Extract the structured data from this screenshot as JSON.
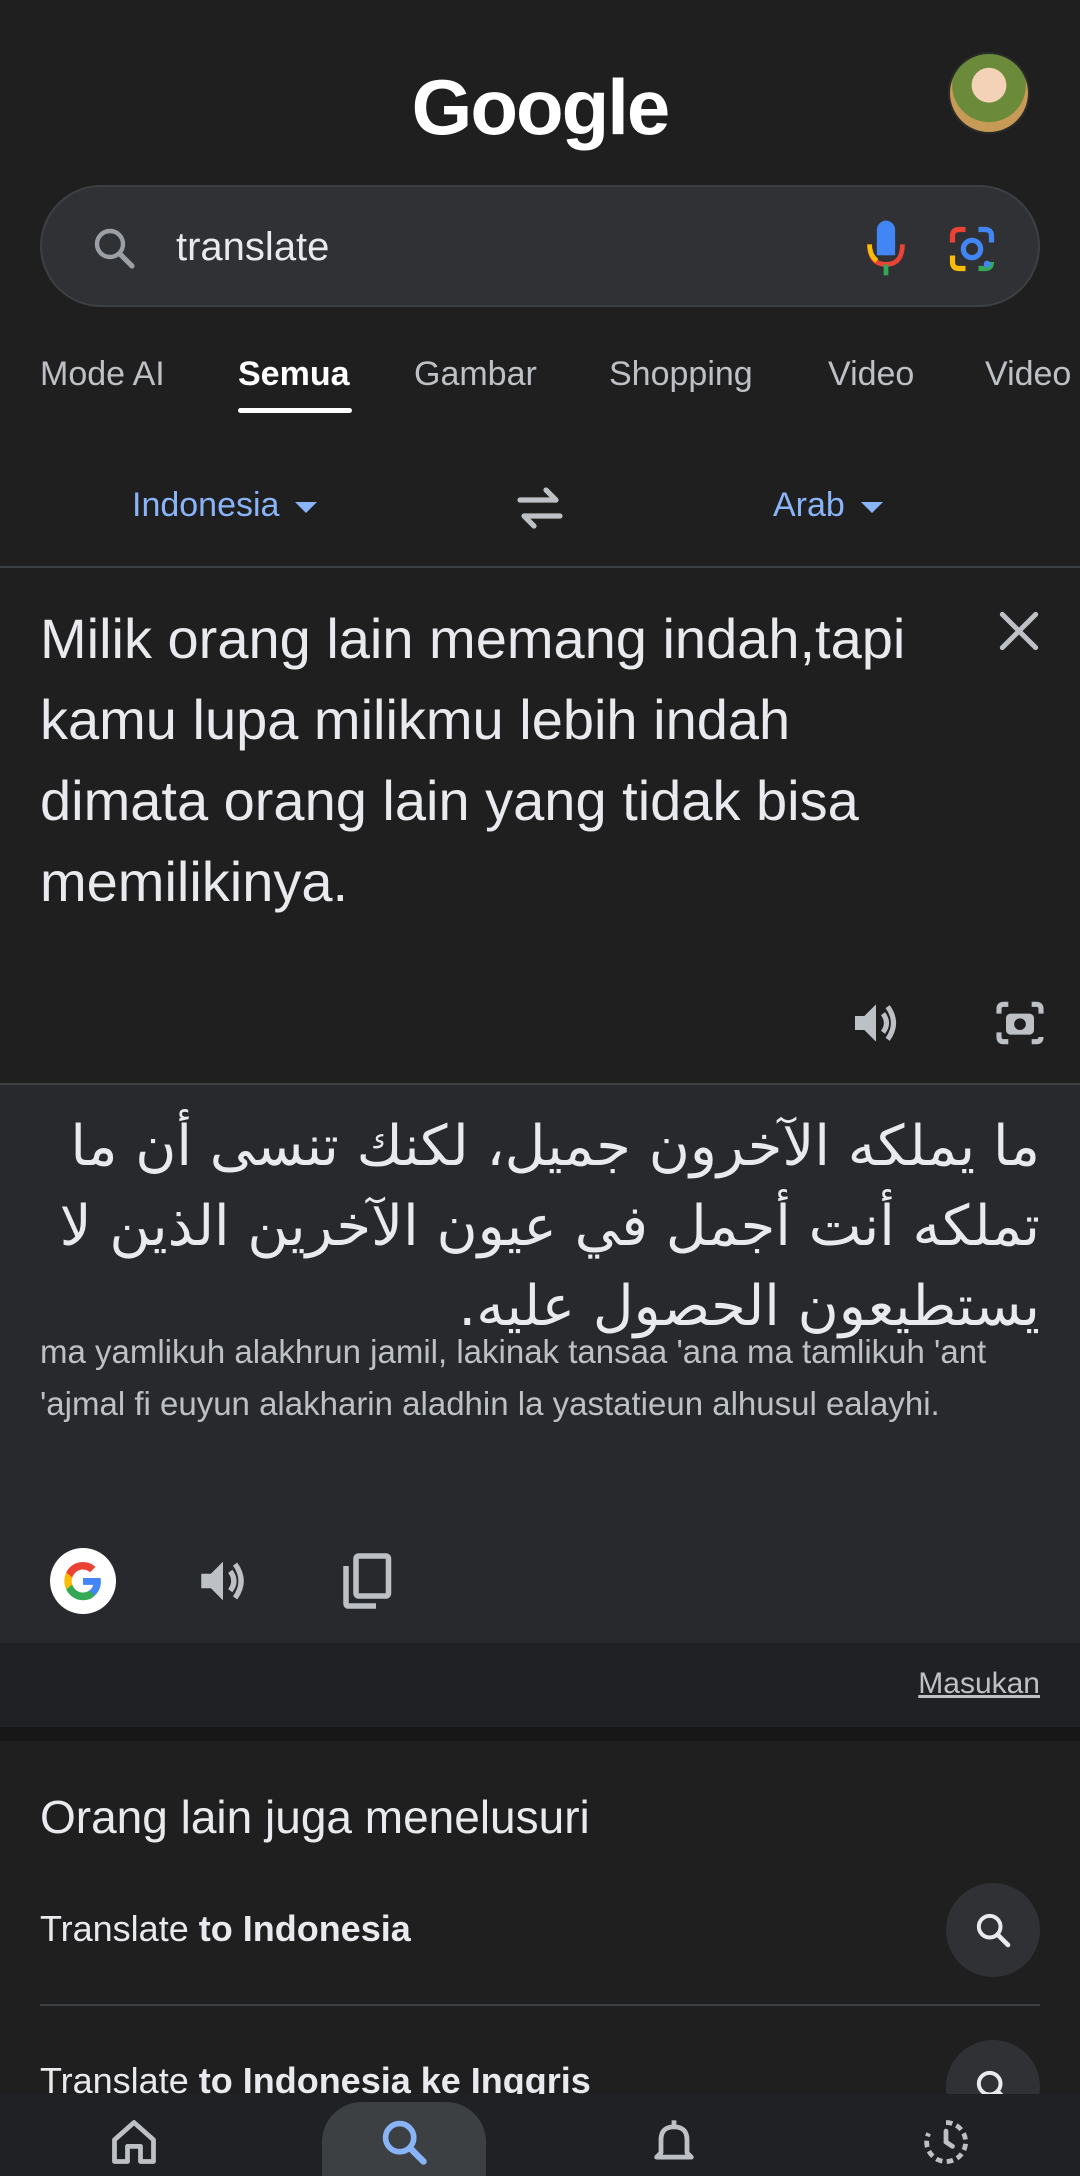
{
  "header": {
    "logo_text": "Google",
    "avatar": "profile-avatar"
  },
  "search": {
    "query": "translate",
    "icons": [
      "search-icon",
      "mic-icon",
      "google-lens-icon"
    ]
  },
  "tabs": [
    {
      "label": "Mode AI",
      "active": false
    },
    {
      "label": "Semua",
      "active": true
    },
    {
      "label": "Gambar",
      "active": false
    },
    {
      "label": "Shopping",
      "active": false
    },
    {
      "label": "Video",
      "active": false
    },
    {
      "label": "Video",
      "active": false
    }
  ],
  "translator": {
    "source_language": "Indonesia",
    "target_language": "Arab",
    "source_text": "Milik orang lain memang indah,tapi kamu lupa milikmu lebih indah dimata orang lain yang tidak bisa memilikinya.",
    "translated_text": "ما يملكه الآخرون جميل، لكنك تنسى أن ما تملكه أنت أجمل في عيون الآخرين الذين لا يستطيعون الحصول عليه.",
    "transliteration": "ma yamlikuh alakhrun jamil, lakinak tansaa 'ana ma tamlikuh 'ant 'ajmal fi euyun alakharin aladhin la yastatieun alhusul ealayhi.",
    "feedback_link": "Masukan"
  },
  "people_also_search": {
    "title": "Orang lain juga menelusuri",
    "items": [
      {
        "prefix": "Translate ",
        "bold": "to Indonesia"
      },
      {
        "prefix": "Translate ",
        "bold": "to Indonesia ke Inggris"
      }
    ]
  },
  "bottom_nav": {
    "items": [
      "home-icon",
      "search-icon",
      "notifications-icon",
      "activity-icon"
    ],
    "active": "search-icon"
  },
  "colors": {
    "background": "#1f1f1f",
    "link": "#8ab4f8",
    "result_panel": "#28292c"
  }
}
